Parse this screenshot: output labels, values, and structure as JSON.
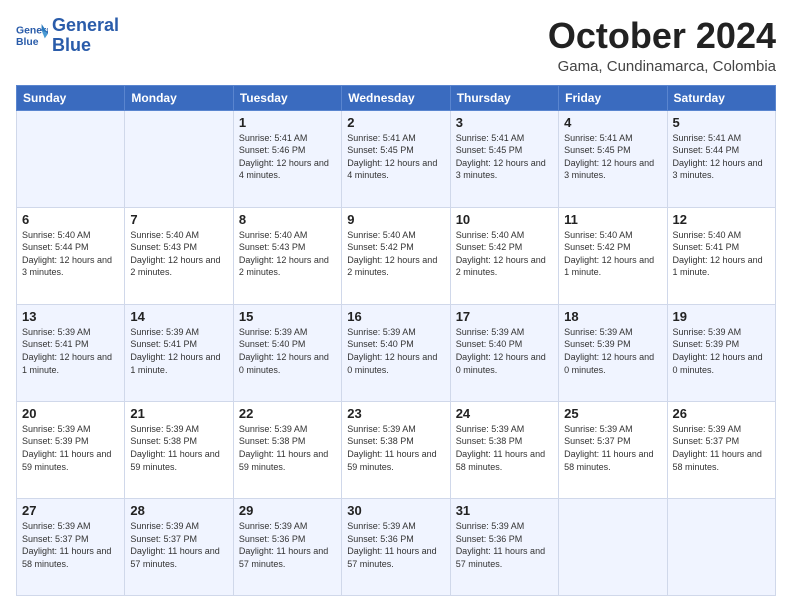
{
  "logo": {
    "line1": "General",
    "line2": "Blue"
  },
  "title": "October 2024",
  "location": "Gama, Cundinamarca, Colombia",
  "weekdays": [
    "Sunday",
    "Monday",
    "Tuesday",
    "Wednesday",
    "Thursday",
    "Friday",
    "Saturday"
  ],
  "weeks": [
    [
      {
        "day": "",
        "sunrise": "",
        "sunset": "",
        "daylight": ""
      },
      {
        "day": "",
        "sunrise": "",
        "sunset": "",
        "daylight": ""
      },
      {
        "day": "1",
        "sunrise": "Sunrise: 5:41 AM",
        "sunset": "Sunset: 5:46 PM",
        "daylight": "Daylight: 12 hours and 4 minutes."
      },
      {
        "day": "2",
        "sunrise": "Sunrise: 5:41 AM",
        "sunset": "Sunset: 5:45 PM",
        "daylight": "Daylight: 12 hours and 4 minutes."
      },
      {
        "day": "3",
        "sunrise": "Sunrise: 5:41 AM",
        "sunset": "Sunset: 5:45 PM",
        "daylight": "Daylight: 12 hours and 3 minutes."
      },
      {
        "day": "4",
        "sunrise": "Sunrise: 5:41 AM",
        "sunset": "Sunset: 5:45 PM",
        "daylight": "Daylight: 12 hours and 3 minutes."
      },
      {
        "day": "5",
        "sunrise": "Sunrise: 5:41 AM",
        "sunset": "Sunset: 5:44 PM",
        "daylight": "Daylight: 12 hours and 3 minutes."
      }
    ],
    [
      {
        "day": "6",
        "sunrise": "Sunrise: 5:40 AM",
        "sunset": "Sunset: 5:44 PM",
        "daylight": "Daylight: 12 hours and 3 minutes."
      },
      {
        "day": "7",
        "sunrise": "Sunrise: 5:40 AM",
        "sunset": "Sunset: 5:43 PM",
        "daylight": "Daylight: 12 hours and 2 minutes."
      },
      {
        "day": "8",
        "sunrise": "Sunrise: 5:40 AM",
        "sunset": "Sunset: 5:43 PM",
        "daylight": "Daylight: 12 hours and 2 minutes."
      },
      {
        "day": "9",
        "sunrise": "Sunrise: 5:40 AM",
        "sunset": "Sunset: 5:42 PM",
        "daylight": "Daylight: 12 hours and 2 minutes."
      },
      {
        "day": "10",
        "sunrise": "Sunrise: 5:40 AM",
        "sunset": "Sunset: 5:42 PM",
        "daylight": "Daylight: 12 hours and 2 minutes."
      },
      {
        "day": "11",
        "sunrise": "Sunrise: 5:40 AM",
        "sunset": "Sunset: 5:42 PM",
        "daylight": "Daylight: 12 hours and 1 minute."
      },
      {
        "day": "12",
        "sunrise": "Sunrise: 5:40 AM",
        "sunset": "Sunset: 5:41 PM",
        "daylight": "Daylight: 12 hours and 1 minute."
      }
    ],
    [
      {
        "day": "13",
        "sunrise": "Sunrise: 5:39 AM",
        "sunset": "Sunset: 5:41 PM",
        "daylight": "Daylight: 12 hours and 1 minute."
      },
      {
        "day": "14",
        "sunrise": "Sunrise: 5:39 AM",
        "sunset": "Sunset: 5:41 PM",
        "daylight": "Daylight: 12 hours and 1 minute."
      },
      {
        "day": "15",
        "sunrise": "Sunrise: 5:39 AM",
        "sunset": "Sunset: 5:40 PM",
        "daylight": "Daylight: 12 hours and 0 minutes."
      },
      {
        "day": "16",
        "sunrise": "Sunrise: 5:39 AM",
        "sunset": "Sunset: 5:40 PM",
        "daylight": "Daylight: 12 hours and 0 minutes."
      },
      {
        "day": "17",
        "sunrise": "Sunrise: 5:39 AM",
        "sunset": "Sunset: 5:40 PM",
        "daylight": "Daylight: 12 hours and 0 minutes."
      },
      {
        "day": "18",
        "sunrise": "Sunrise: 5:39 AM",
        "sunset": "Sunset: 5:39 PM",
        "daylight": "Daylight: 12 hours and 0 minutes."
      },
      {
        "day": "19",
        "sunrise": "Sunrise: 5:39 AM",
        "sunset": "Sunset: 5:39 PM",
        "daylight": "Daylight: 12 hours and 0 minutes."
      }
    ],
    [
      {
        "day": "20",
        "sunrise": "Sunrise: 5:39 AM",
        "sunset": "Sunset: 5:39 PM",
        "daylight": "Daylight: 11 hours and 59 minutes."
      },
      {
        "day": "21",
        "sunrise": "Sunrise: 5:39 AM",
        "sunset": "Sunset: 5:38 PM",
        "daylight": "Daylight: 11 hours and 59 minutes."
      },
      {
        "day": "22",
        "sunrise": "Sunrise: 5:39 AM",
        "sunset": "Sunset: 5:38 PM",
        "daylight": "Daylight: 11 hours and 59 minutes."
      },
      {
        "day": "23",
        "sunrise": "Sunrise: 5:39 AM",
        "sunset": "Sunset: 5:38 PM",
        "daylight": "Daylight: 11 hours and 59 minutes."
      },
      {
        "day": "24",
        "sunrise": "Sunrise: 5:39 AM",
        "sunset": "Sunset: 5:38 PM",
        "daylight": "Daylight: 11 hours and 58 minutes."
      },
      {
        "day": "25",
        "sunrise": "Sunrise: 5:39 AM",
        "sunset": "Sunset: 5:37 PM",
        "daylight": "Daylight: 11 hours and 58 minutes."
      },
      {
        "day": "26",
        "sunrise": "Sunrise: 5:39 AM",
        "sunset": "Sunset: 5:37 PM",
        "daylight": "Daylight: 11 hours and 58 minutes."
      }
    ],
    [
      {
        "day": "27",
        "sunrise": "Sunrise: 5:39 AM",
        "sunset": "Sunset: 5:37 PM",
        "daylight": "Daylight: 11 hours and 58 minutes."
      },
      {
        "day": "28",
        "sunrise": "Sunrise: 5:39 AM",
        "sunset": "Sunset: 5:37 PM",
        "daylight": "Daylight: 11 hours and 57 minutes."
      },
      {
        "day": "29",
        "sunrise": "Sunrise: 5:39 AM",
        "sunset": "Sunset: 5:36 PM",
        "daylight": "Daylight: 11 hours and 57 minutes."
      },
      {
        "day": "30",
        "sunrise": "Sunrise: 5:39 AM",
        "sunset": "Sunset: 5:36 PM",
        "daylight": "Daylight: 11 hours and 57 minutes."
      },
      {
        "day": "31",
        "sunrise": "Sunrise: 5:39 AM",
        "sunset": "Sunset: 5:36 PM",
        "daylight": "Daylight: 11 hours and 57 minutes."
      },
      {
        "day": "",
        "sunrise": "",
        "sunset": "",
        "daylight": ""
      },
      {
        "day": "",
        "sunrise": "",
        "sunset": "",
        "daylight": ""
      }
    ]
  ]
}
